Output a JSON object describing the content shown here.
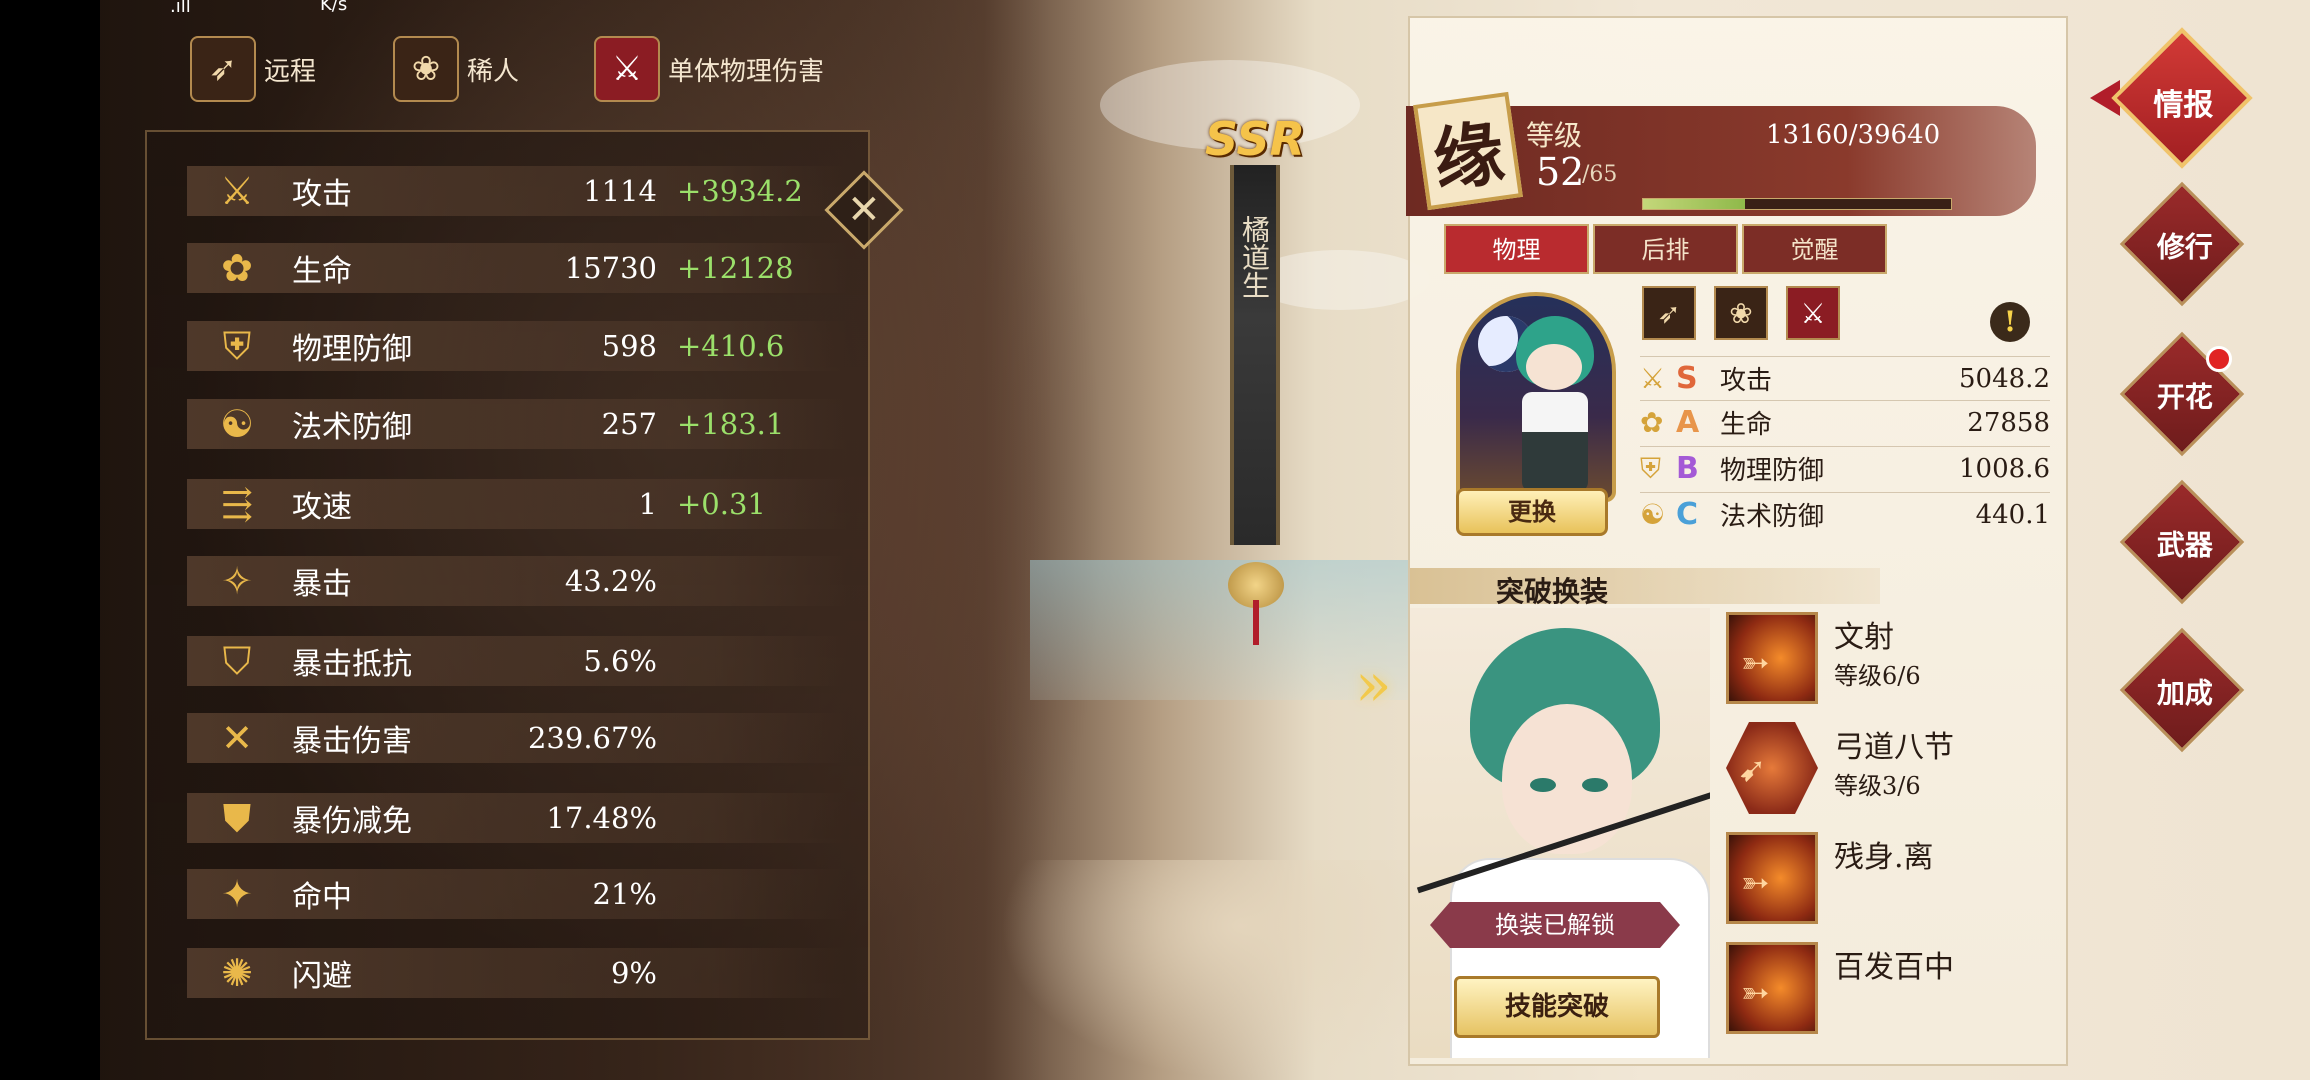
{
  "statusbar": {
    "signal": ".ıll",
    "speed": "K/s"
  },
  "tags": [
    {
      "icon": "bow-icon",
      "label": "远程"
    },
    {
      "icon": "lotus-icon",
      "label": "稀人"
    },
    {
      "icon": "slash-icon",
      "label": "单体物理伤害"
    }
  ],
  "stats": [
    {
      "icon": "sword-icon",
      "name": "攻击",
      "value": "1114",
      "bonus": "+3934.2"
    },
    {
      "icon": "flower-icon",
      "name": "生命",
      "value": "15730",
      "bonus": "+12128"
    },
    {
      "icon": "armor-icon",
      "name": "物理防御",
      "value": "598",
      "bonus": "+410.6"
    },
    {
      "icon": "yinyang-icon",
      "name": "法术防御",
      "value": "257",
      "bonus": "+183.1"
    },
    {
      "icon": "speed-icon",
      "name": "攻速",
      "value": "1",
      "bonus": "+0.31"
    },
    {
      "icon": "crit-icon",
      "name": "暴击",
      "value": "43.2%",
      "bonus": ""
    },
    {
      "icon": "crit-resist-icon",
      "name": "暴击抵抗",
      "value": "5.6%",
      "bonus": ""
    },
    {
      "icon": "crit-damage-icon",
      "name": "暴击伤害",
      "value": "239.67%",
      "bonus": ""
    },
    {
      "icon": "crit-reduce-icon",
      "name": "暴伤减免",
      "value": "17.48%",
      "bonus": ""
    },
    {
      "icon": "hit-icon",
      "name": "命中",
      "value": "21%",
      "bonus": ""
    },
    {
      "icon": "dodge-icon",
      "name": "闪避",
      "value": "9%",
      "bonus": ""
    }
  ],
  "character": {
    "rarity": "SSR",
    "name": "橘道生",
    "yuan": "缘",
    "level_label": "等级",
    "level": "52",
    "level_max": "/65",
    "exp_text": "13160/39640",
    "exp_fraction": 0.332
  },
  "tabs": [
    "物理",
    "后排",
    "觉醒"
  ],
  "swap_button": "更换",
  "attributes": [
    {
      "icon": "sword-icon",
      "grade": "S",
      "grade_color": "#e0673a",
      "name": "攻击",
      "value": "5048.2"
    },
    {
      "icon": "flower-icon",
      "grade": "A",
      "grade_color": "#e8954a",
      "name": "生命",
      "value": "27858"
    },
    {
      "icon": "armor-icon",
      "grade": "B",
      "grade_color": "#a45ad6",
      "name": "物理防御",
      "value": "1008.6"
    },
    {
      "icon": "yinyang-icon",
      "grade": "C",
      "grade_color": "#4aa0d8",
      "name": "法术防御",
      "value": "440.1"
    }
  ],
  "breakthrough": {
    "title": "突破换装",
    "unlock_tag": "换装已解锁",
    "button": "技能突破"
  },
  "skills": [
    {
      "name": "文射",
      "level": "等级6/6"
    },
    {
      "name": "弓道八节",
      "level": "等级3/6"
    },
    {
      "name": "残身.离",
      "level": ""
    },
    {
      "name": "百发百中",
      "level": ""
    }
  ],
  "menu": [
    "情报",
    "修行",
    "开花",
    "武器",
    "加成"
  ],
  "colors": {
    "accent_red": "#b92b2f",
    "gold": "#e9b84a",
    "bonus_green": "#9be06a"
  }
}
